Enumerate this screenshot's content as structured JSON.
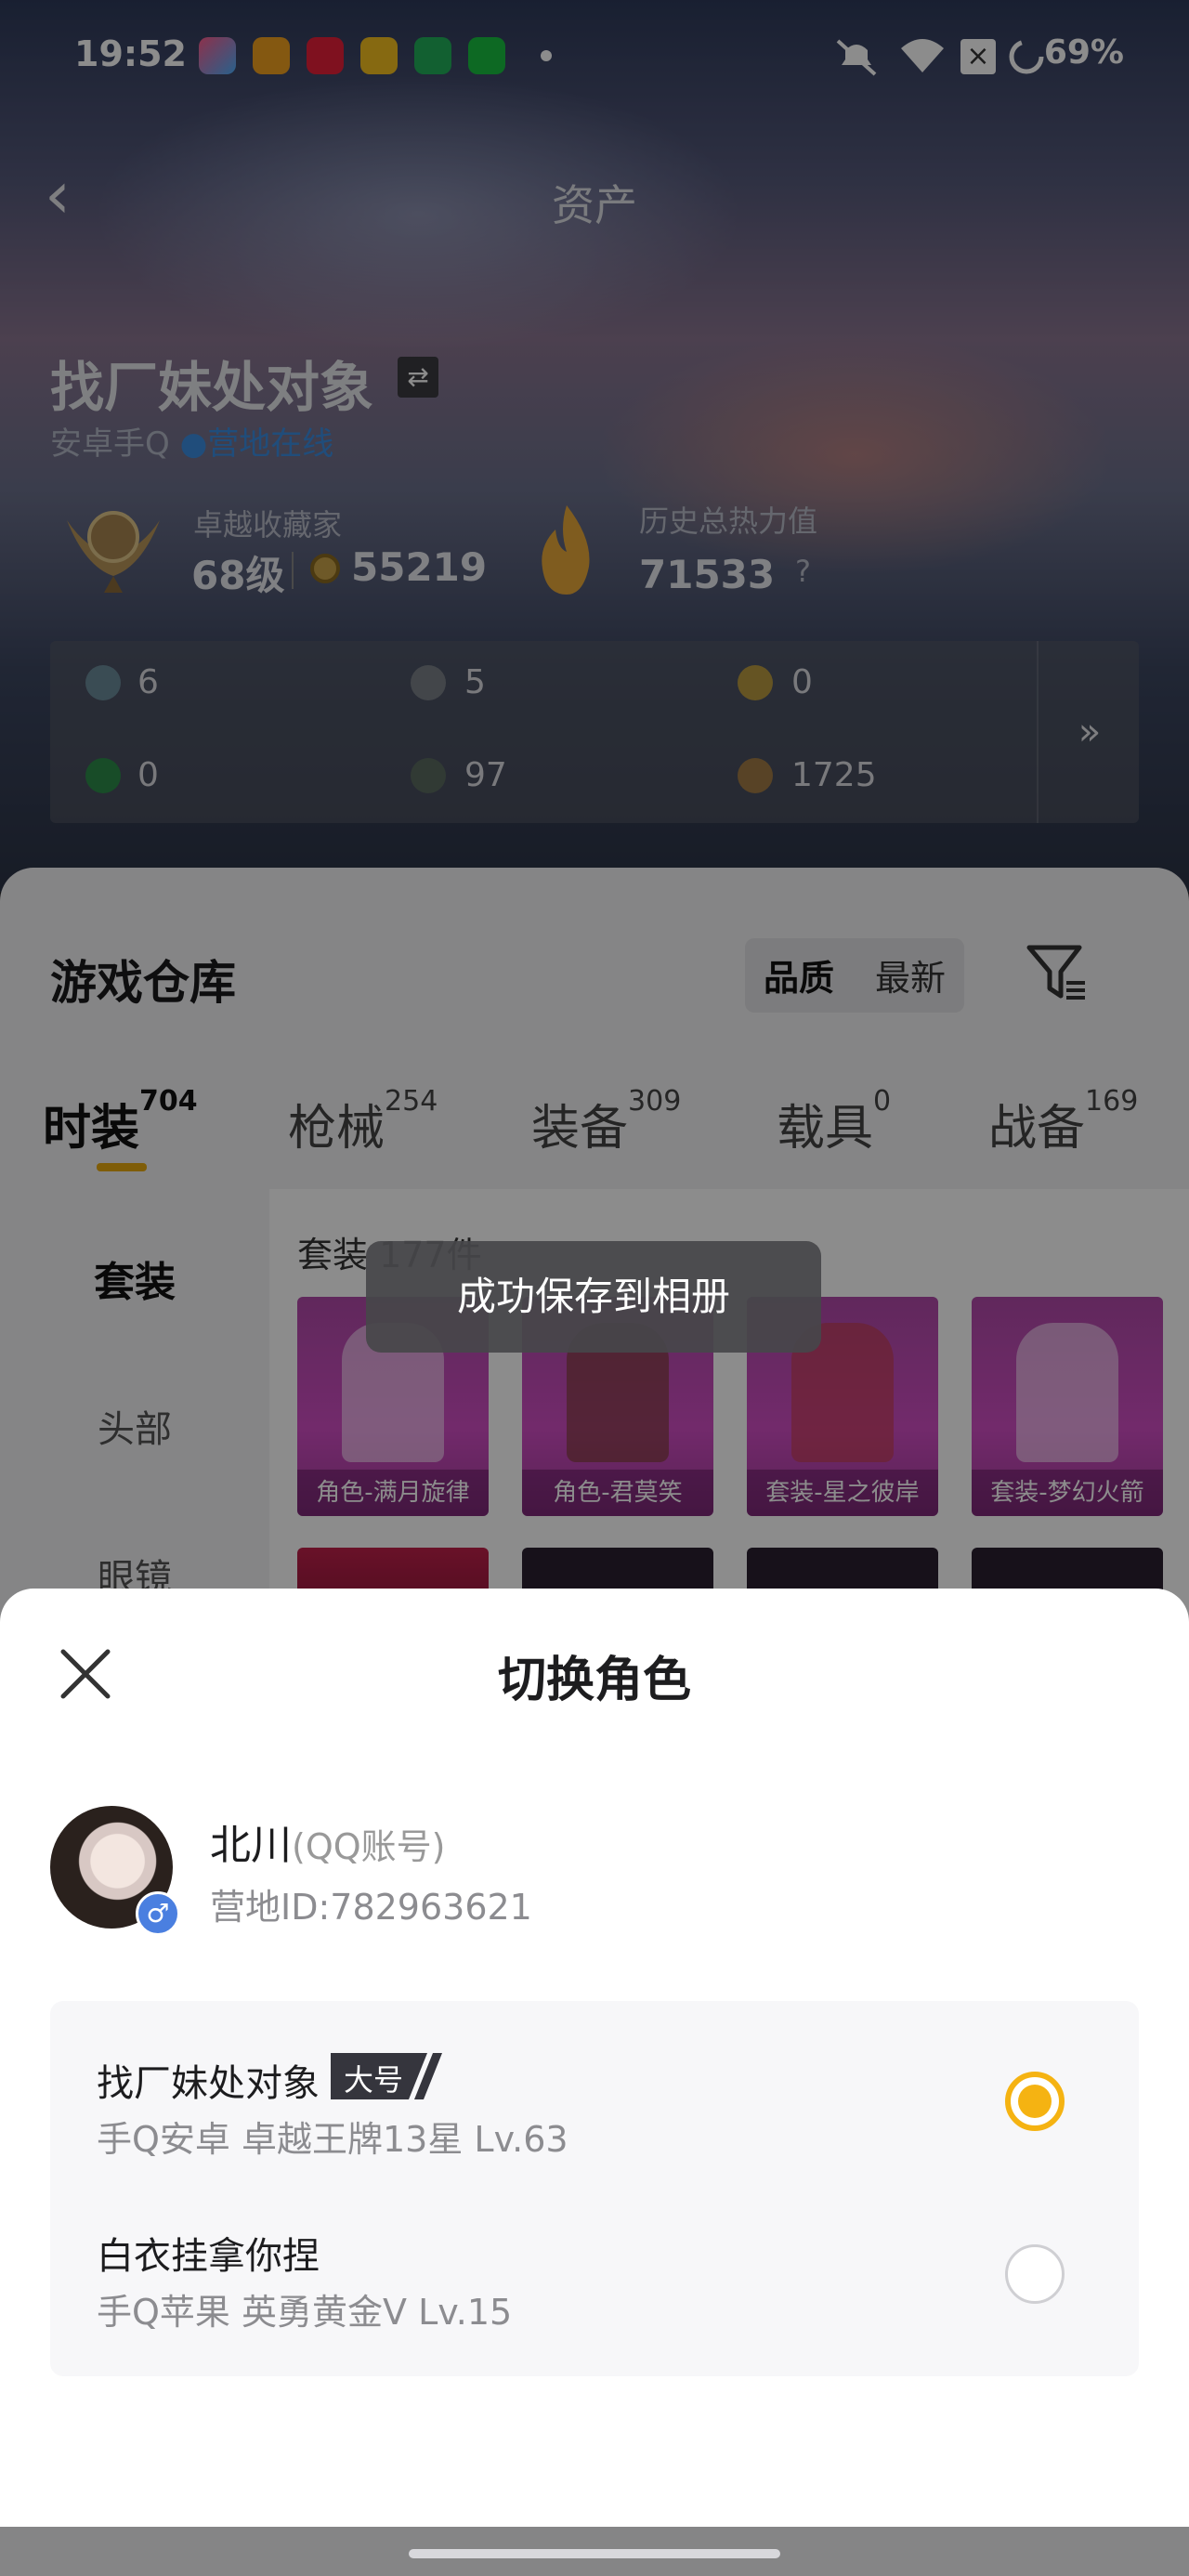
{
  "status_bar": {
    "time": "19:52",
    "battery": "69%"
  },
  "header": {
    "title": "资产",
    "back_glyph": "‹"
  },
  "profile": {
    "name": "找厂妹处对象",
    "swap_glyph": "⇄",
    "platform": "安卓手Q",
    "online": "营地在线",
    "collector_label": "卓越收藏家",
    "level": "68级",
    "collect_points": "55219",
    "heat_label": "历史总热力值",
    "heat_value": "71533",
    "heat_help": "?"
  },
  "stats": {
    "items": [
      {
        "value": "6",
        "color": "#6b8a9a"
      },
      {
        "value": "5",
        "color": "#7a8088"
      },
      {
        "value": "0",
        "color": "#b89a40"
      },
      {
        "value": "0",
        "color": "#2d8a4a"
      },
      {
        "value": "97",
        "color": "#5a6a60"
      },
      {
        "value": "1725",
        "color": "#a07a45"
      }
    ],
    "more_glyph": "»"
  },
  "warehouse": {
    "title": "游戏仓库",
    "sort": [
      "品质",
      "最新"
    ],
    "tabs": [
      {
        "label": "时装",
        "count": "704"
      },
      {
        "label": "枪械",
        "count": "254"
      },
      {
        "label": "装备",
        "count": "309"
      },
      {
        "label": "载具",
        "count": "0"
      },
      {
        "label": "战备",
        "count": "169"
      }
    ],
    "sidebar": [
      "套装",
      "头部",
      "眼镜"
    ],
    "content_title": "套装 177件",
    "cards": [
      "角色-满月旋律",
      "角色-君莫笑",
      "套装-星之彼岸",
      "套装-梦幻火箭"
    ]
  },
  "toast": "成功保存到相册",
  "sheet": {
    "title": "切换角色",
    "account": {
      "name": "北川",
      "type": "(QQ账号)",
      "id": "营地ID:782963621",
      "gender": "♂"
    },
    "roles": [
      {
        "name": "找厂妹处对象",
        "badge": "大号",
        "detail": "手Q安卓  卓越王牌13星  Lv.63",
        "selected": true
      },
      {
        "name": "白衣挂拿你捏",
        "badge": "",
        "detail": "手Q苹果  英勇黄金V  Lv.15",
        "selected": false
      }
    ]
  },
  "colors": {
    "accent": "#f5b312",
    "online": "#3b8de0"
  }
}
